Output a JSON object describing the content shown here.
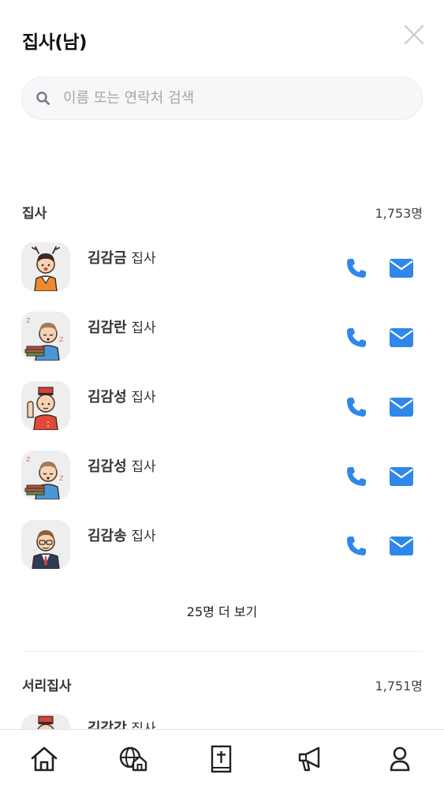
{
  "header": {
    "title": "집사(남)"
  },
  "search": {
    "placeholder": "이름 또는 연락처 검색"
  },
  "sections": [
    {
      "title": "집사",
      "count": "1,753명",
      "members": [
        {
          "name": "김감금",
          "role": "집사"
        },
        {
          "name": "김감란",
          "role": "집사"
        },
        {
          "name": "김감성",
          "role": "집사"
        },
        {
          "name": "김감성",
          "role": "집사"
        },
        {
          "name": "김감송",
          "role": "집사"
        }
      ],
      "more_label": "25명 더 보기"
    },
    {
      "title": "서리집사",
      "count": "1,751명",
      "members": [
        {
          "name": "김감강",
          "role": "집사"
        }
      ]
    }
  ],
  "colors": {
    "accent": "#2f86eb",
    "text": "#333333",
    "nav_icon": "#222222"
  },
  "nav": [
    {
      "icon": "home-icon"
    },
    {
      "icon": "globe-home-icon"
    },
    {
      "icon": "bible-icon"
    },
    {
      "icon": "megaphone-icon"
    },
    {
      "icon": "user-icon"
    }
  ]
}
